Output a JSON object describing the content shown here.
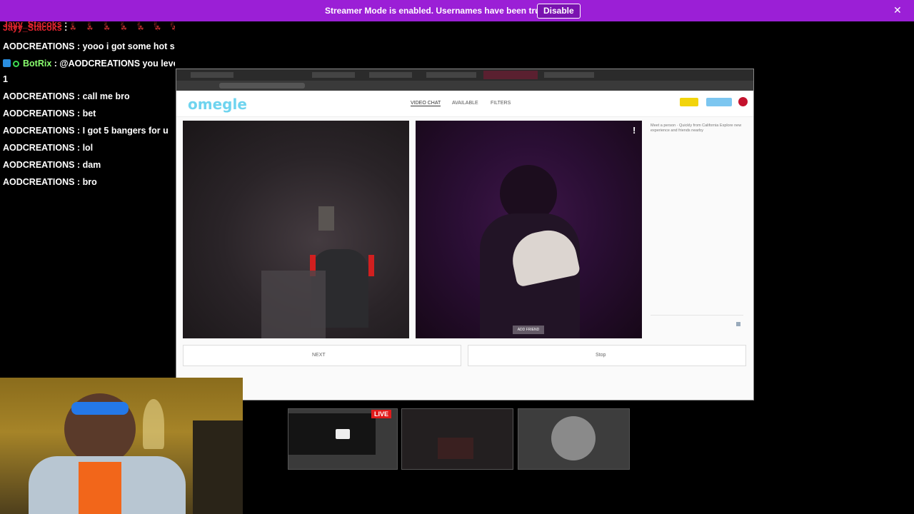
{
  "banner": {
    "text": "Streamer Mode is enabled. Usernames have been truncated.",
    "button": "Disable",
    "close": "✕"
  },
  "chat": [
    {
      "user": "Jayy_Stacoks",
      "sep": " : ",
      "text": "✌ ✌ ✌ ✌ ✌ ✌ ✌ ✌ ✌ ✌ ✌ ✌",
      "style": "red-dots"
    },
    {
      "user": "Jayy_Stacoks",
      "sep": " : ",
      "text": "☘ ☘ ☘ ☘ ☘ ☘ ☘ ☘ ☘",
      "style": "red-dots"
    },
    {
      "user": "AODCREATIONS",
      "sep": " : ",
      "text": "yooo i got some hot shit"
    },
    {
      "user": "BotRix",
      "sep": " : ",
      "text": "@AODCREATIONS you leveled up to Level",
      "style": "bot"
    },
    {
      "user": "",
      "sep": "",
      "text": "1"
    },
    {
      "user": "AODCREATIONS",
      "sep": " : ",
      "text": "call me bro"
    },
    {
      "user": "AODCREATIONS",
      "sep": " : ",
      "text": "bet"
    },
    {
      "user": "AODCREATIONS",
      "sep": " : ",
      "text": "I got 5 bangers for u"
    },
    {
      "user": "AODCREATIONS",
      "sep": " : ",
      "text": "lol"
    },
    {
      "user": "AODCREATIONS",
      "sep": " : ",
      "text": "dam"
    },
    {
      "user": "AODCREATIONS",
      "sep": " : ",
      "text": "bro"
    }
  ],
  "site": {
    "logo": "omegle",
    "nav": [
      "VIDEO CHAT",
      "AVAILABLE",
      "FILTERS"
    ],
    "exclaim": "!",
    "add_friend": "ADD FRIEND",
    "side_text": "Meet a person · Quickly from California Explore new experience and friends nearby",
    "next_label": "NEXT",
    "stop_label": "Stop"
  },
  "live_badge": "LIVE",
  "colors": {
    "banner": "#9b1fd6",
    "user_green": "#8aff6f",
    "user_red": "#e0242f"
  }
}
